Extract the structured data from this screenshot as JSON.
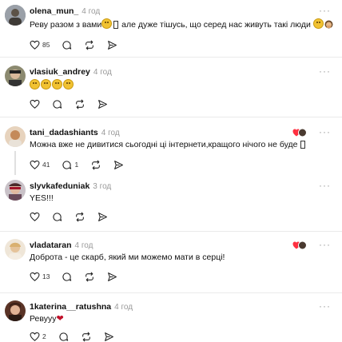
{
  "comments": [
    {
      "username": "olena_mun_",
      "time": "4 год",
      "text_before": "Реву разом з вами",
      "text_after": " але дуже тішусь, що серед нас живуть такі люди ",
      "likes": "85",
      "replies": "",
      "avatar_color": "#8a8f98"
    },
    {
      "username": "vlasiuk_andrey",
      "time": "4 год",
      "likes": "",
      "replies": "",
      "avatar_color": "#6b6b5a"
    },
    {
      "username": "tani_dadashiants",
      "time": "4 год",
      "text": "Можна вже не дивитися сьогодні ці інтернети,кращого нічого не буде ",
      "likes": "41",
      "replies": "1",
      "avatar_color": "#d9b38c"
    },
    {
      "username": "slyvkafeduniak",
      "time": "3 год",
      "text": "YES!!!",
      "likes": "",
      "replies": "",
      "avatar_color": "#b44a5a"
    },
    {
      "username": "vladataran",
      "time": "4 год",
      "text": "Доброта - це скарб, який ми можемо мати в серці!",
      "likes": "13",
      "replies": "",
      "avatar_color": "#e4d7c5"
    },
    {
      "username": "1katerina__ratushna",
      "time": "4 год",
      "text": "Ревууу",
      "likes": "2",
      "replies": "",
      "avatar_color": "#6a3b2a"
    }
  ],
  "icons": {
    "like": "heart-outline-icon",
    "reply": "comment-bubble-icon",
    "repost": "repost-icon",
    "share": "send-icon",
    "more": "more-dots-icon"
  },
  "colors": {
    "author_like_heart": "#ff3040",
    "muted": "#999999"
  }
}
